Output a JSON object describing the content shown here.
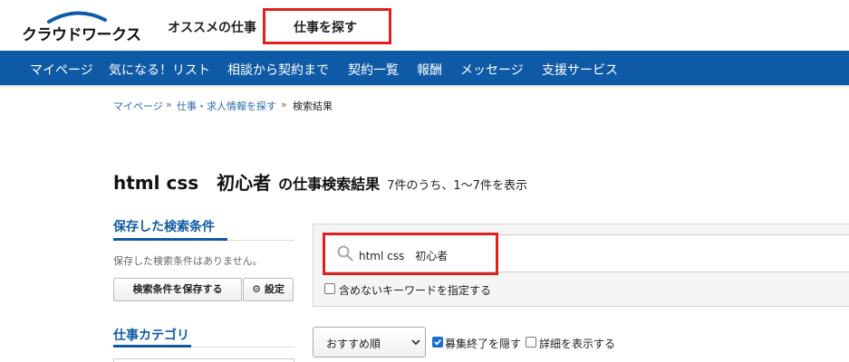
{
  "header": {
    "logo_text": "クラウドワークス",
    "links": [
      "オススメの仕事",
      "仕事を探す"
    ]
  },
  "nav": {
    "items": [
      "マイページ",
      "気になる！リスト",
      "相談から契約まで",
      "契約一覧",
      "報酬",
      "メッセージ",
      "支援サービス"
    ]
  },
  "breadcrumb": {
    "items": [
      "マイページ",
      "仕事・求人情報を探す",
      "検索結果"
    ],
    "separator": "»"
  },
  "results": {
    "query": "html css　初心者",
    "suffix": "の仕事検索結果",
    "count_text": "7件のうち、1〜7件を表示"
  },
  "sidebar": {
    "saved_heading": "保存した検索条件",
    "saved_empty": "保存した検索条件はありません。",
    "save_button": "検索条件を保存する",
    "settings_button": "設定",
    "category_heading": "仕事カテゴリ"
  },
  "search": {
    "value": "html css　初心者",
    "exclude_label": "含めないキーワードを指定する"
  },
  "filters": {
    "sort_selected": "おすすめ順",
    "hide_closed_label": "募集終了を隠す",
    "hide_closed_checked": true,
    "show_detail_label": "詳細を表示する",
    "show_detail_checked": false
  },
  "colors": {
    "brand_blue": "#0f5aa6",
    "highlight_red": "#e02020",
    "link_blue": "#2a6bb2"
  }
}
